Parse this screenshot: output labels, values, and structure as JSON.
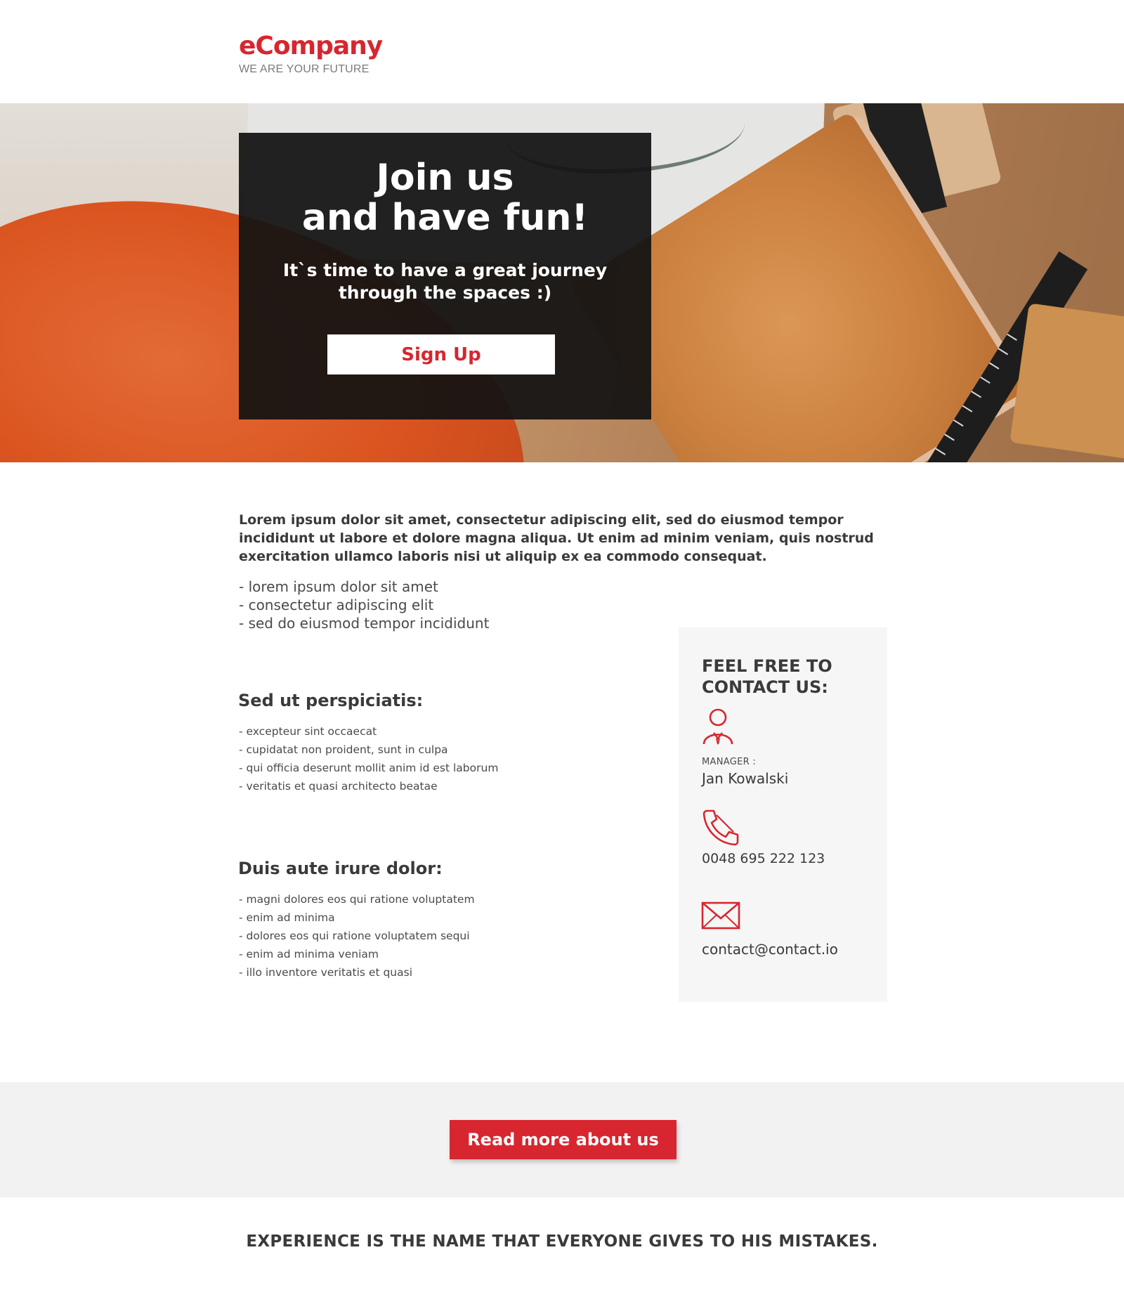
{
  "header": {
    "logo_name": "eCompany",
    "logo_tagline": "WE ARE YOUR FUTURE"
  },
  "hero": {
    "title_line1": "Join us",
    "title_line2": "and have fun!",
    "subtitle_line1": "It`s time to have a great journey",
    "subtitle_line2": "through the spaces :)",
    "signup_label": "Sign Up"
  },
  "intro": {
    "paragraph": "Lorem ipsum dolor sit amet, consectetur adipiscing elit, sed do eiusmod tempor incididunt ut labore et dolore magna aliqua. Ut enim ad minim veniam, quis nostrud exercitation ullamco laboris nisi ut aliquip ex ea commodo consequat.",
    "list": [
      "- lorem ipsum dolor sit amet",
      "- consectetur adipiscing elit",
      "- sed do eiusmod tempor incididunt"
    ]
  },
  "section1": {
    "title": "Sed ut perspiciatis:",
    "items": [
      "- excepteur sint occaecat",
      "- cupidatat non proident, sunt in culpa",
      "- qui officia deserunt mollit anim id est laborum",
      "- veritatis et quasi architecto beatae"
    ]
  },
  "section2": {
    "title": "Duis aute irure dolor:",
    "items": [
      "- magni dolores eos qui ratione voluptatem",
      "- enim ad minima",
      "- dolores eos qui ratione voluptatem sequi",
      "- enim ad minima veniam",
      "- illo inventore veritatis et quasi"
    ]
  },
  "contact": {
    "title_line1": "FEEL FREE TO",
    "title_line2": "CONTACT US:",
    "manager_label": "MANAGER :",
    "manager_name": "Jan Kowalski",
    "phone": "0048 695 222 123",
    "email": "contact@contact.io",
    "icons": [
      "person-icon",
      "phone-icon",
      "envelope-icon"
    ]
  },
  "cta": {
    "label": "Read more about us"
  },
  "quote": "EXPERIENCE IS THE NAME THAT EVERYONE GIVES TO HIS MISTAKES.",
  "colors": {
    "accent": "#d7262f",
    "text": "#3a3a3a",
    "panel": "#121212",
    "band": "#f2f2f2",
    "card": "#f6f6f6"
  }
}
